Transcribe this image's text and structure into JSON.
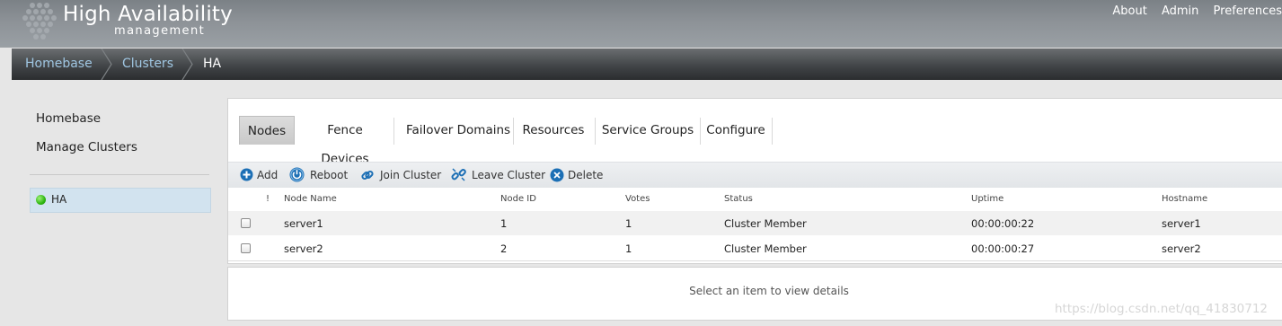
{
  "header": {
    "title": "High Availability",
    "subtitle": "management",
    "links": [
      "About",
      "Admin",
      "Preferences"
    ]
  },
  "breadcrumb": [
    "Homebase",
    "Clusters",
    "HA"
  ],
  "sidebar": {
    "links": [
      "Homebase",
      "Manage Clusters"
    ],
    "clusters": [
      {
        "name": "HA",
        "status_color": "#2db50f"
      }
    ]
  },
  "tabs": [
    "Nodes",
    "Fence Devices",
    "Failover Domains",
    "Resources",
    "Service Groups",
    "Configure"
  ],
  "toolbar": {
    "add": "Add",
    "reboot": "Reboot",
    "join": "Join Cluster",
    "leave": "Leave Cluster",
    "delete": "Delete"
  },
  "table": {
    "columns": [
      "!",
      "Node Name",
      "Node ID",
      "Votes",
      "Status",
      "Uptime",
      "Hostname"
    ],
    "rows": [
      [
        "server1",
        "1",
        "1",
        "Cluster Member",
        "00:00:00:22",
        "server1"
      ],
      [
        "server2",
        "2",
        "1",
        "Cluster Member",
        "00:00:00:27",
        "server2"
      ]
    ]
  },
  "details": "Select an item to view details",
  "watermark": "https://blog.csdn.net/qq_41830712",
  "colors": {
    "accent": "#1c6fb5",
    "breadcrumb_link": "#9fc6e2",
    "status_ok": "#2db50f"
  }
}
